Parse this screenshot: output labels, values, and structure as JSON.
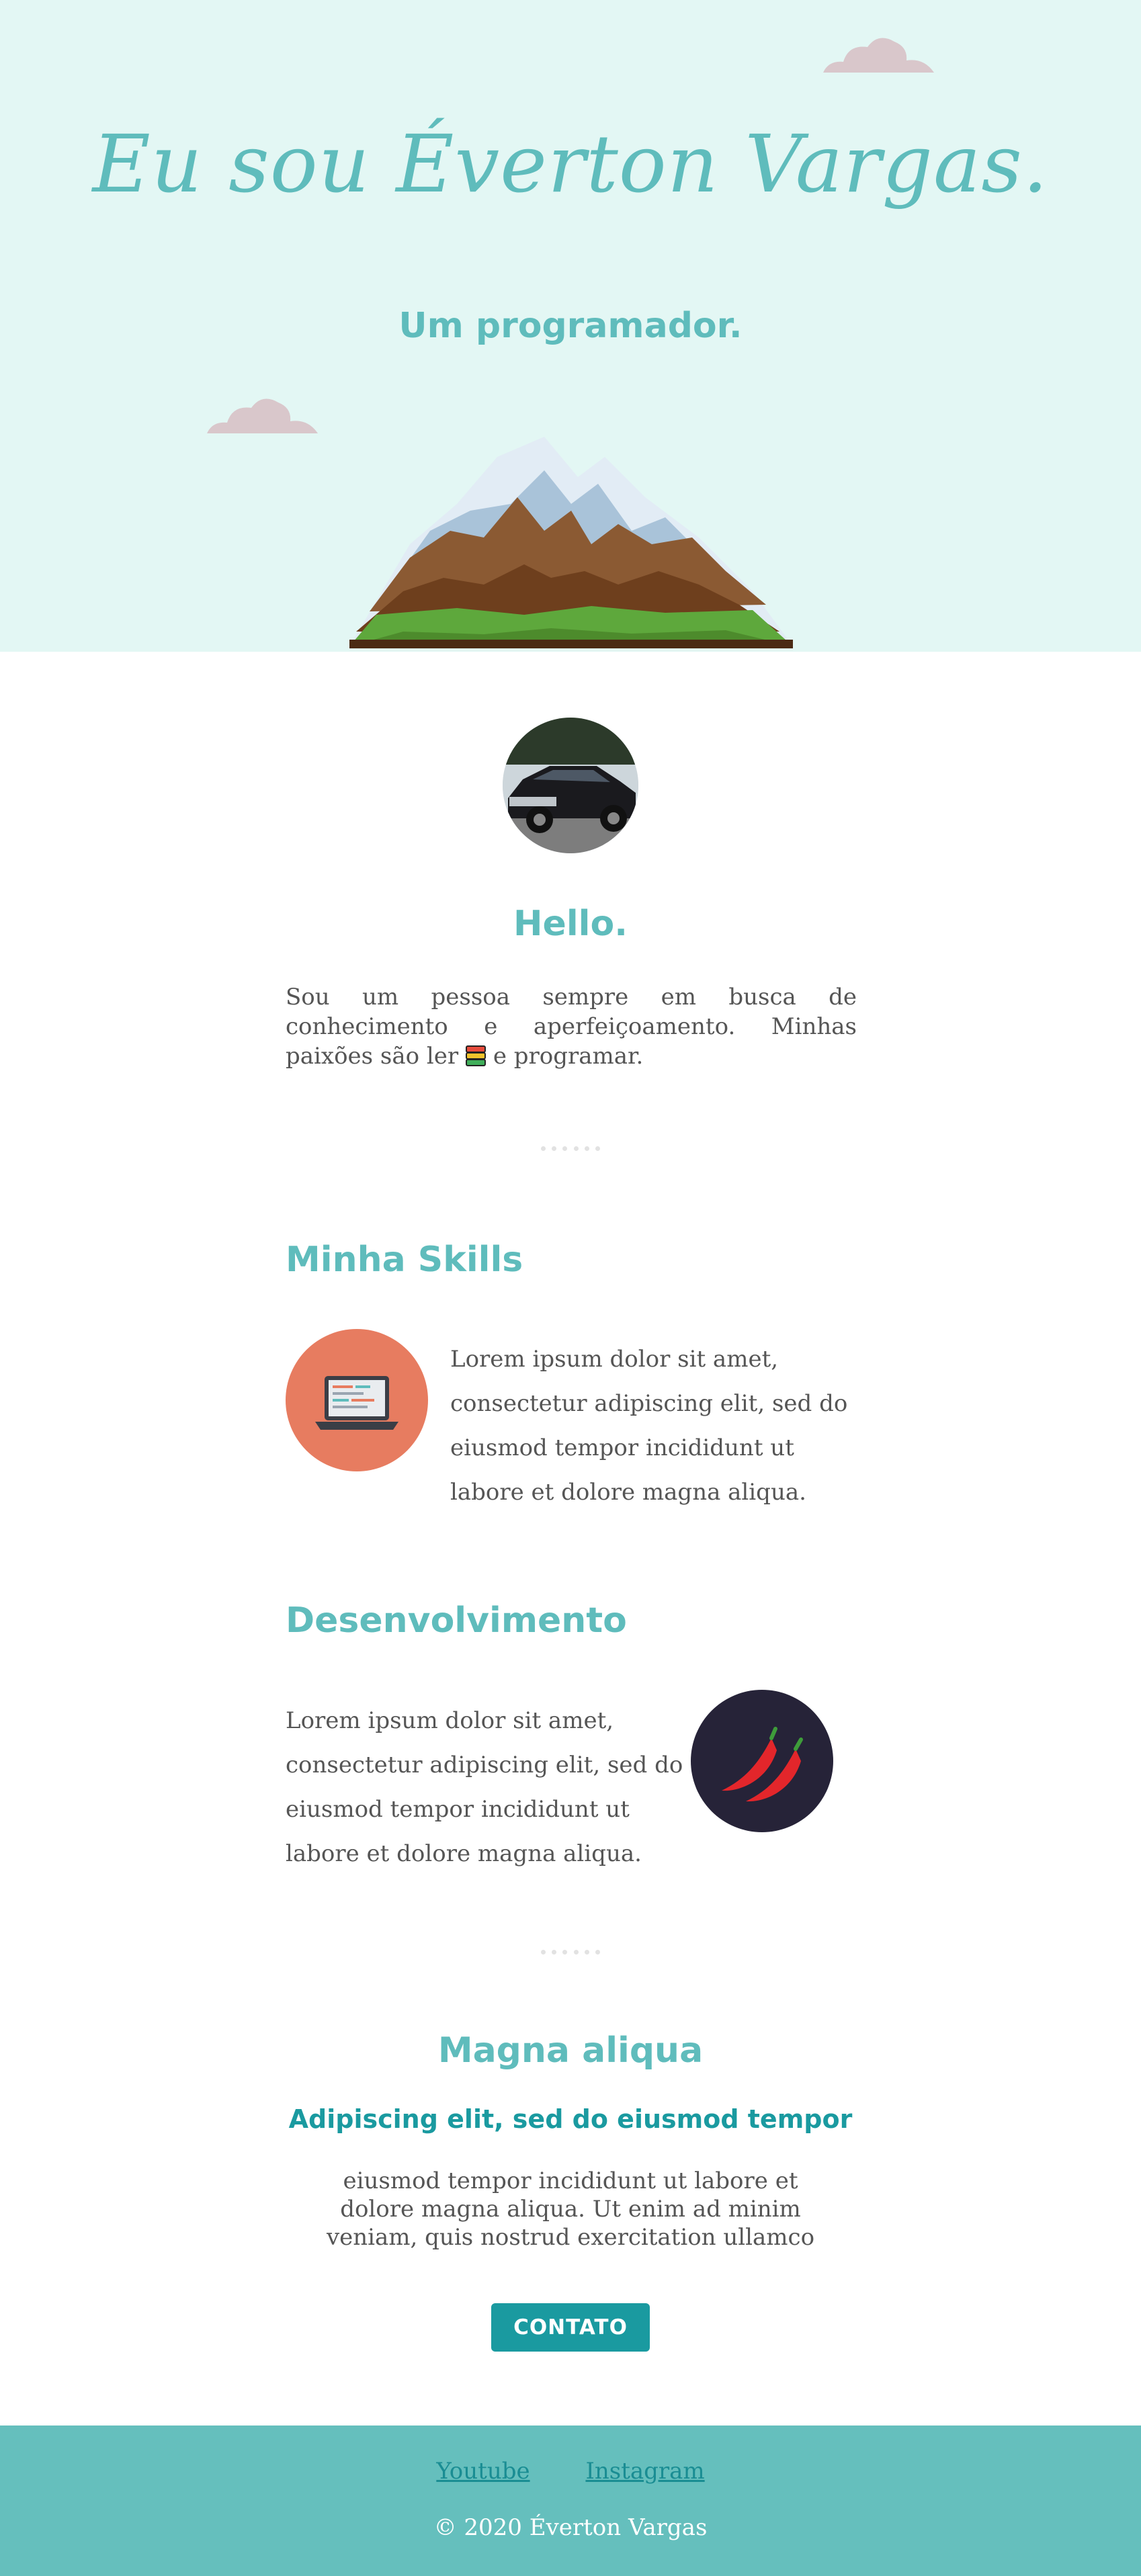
{
  "hero": {
    "title": "Eu sou Éverton Vargas.",
    "subtitle": "Um programador."
  },
  "about": {
    "heading": "Hello.",
    "text_before": "Sou um pessoa sempre em busca de conhecimento e aperfeiçoamento. Minhas paixões são ler",
    "text_after": "e programar."
  },
  "skills": {
    "heading": "Minha Skills",
    "text": "Lorem ipsum dolor sit amet, consectetur adipiscing elit, sed do eiusmod tempor incididunt ut labore et dolore magna aliqua.",
    "icon": "laptop-icon"
  },
  "development": {
    "heading": "Desenvolvimento",
    "text": "Lorem ipsum dolor sit amet, consectetur adipiscing elit, sed do eiusmod tempor incididunt ut labore et dolore magna aliqua.",
    "icon": "chili-pepper-icon"
  },
  "magna": {
    "heading": "Magna aliqua",
    "subheading": "Adipiscing elit, sed do eiusmod tempor",
    "text": "eiusmod tempor incididunt ut labore et dolore magna aliqua. Ut enim ad minim veniam, quis nostrud exercitation ullamco",
    "button_label": "CONTATO"
  },
  "footer": {
    "links": [
      "Youtube",
      "Instagram"
    ],
    "copyright": "© 2020 Éverton Vargas"
  },
  "colors": {
    "hero_bg": "#e3f7f4",
    "accent": "#5fbcbc",
    "button": "#1a9aa0",
    "footer_bg": "#65bfbd",
    "skills_icon_bg": "#e77c60",
    "dev_icon_bg": "#262338"
  }
}
